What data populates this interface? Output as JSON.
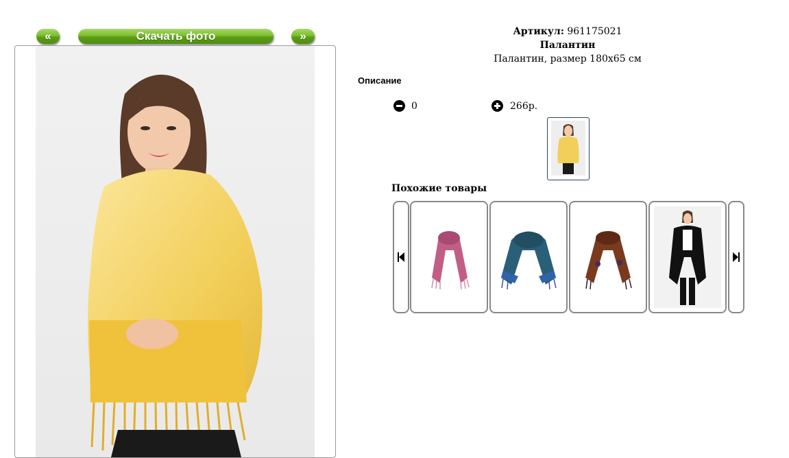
{
  "nav": {
    "prev_label": "«",
    "download_label": "Скачать фото",
    "next_label": "»"
  },
  "product": {
    "article_label": "Артикул:",
    "article_value": "961175021",
    "name": "Палантин",
    "description": "Палантин, размер 180х65 см"
  },
  "description_heading": "Описание",
  "cart": {
    "quantity": "0",
    "price": "266р."
  },
  "similar": {
    "heading": "Похожие товары",
    "items": [
      {
        "kind": "scarf",
        "color": "#c25e86"
      },
      {
        "kind": "scarf",
        "color": "#2a5f78"
      },
      {
        "kind": "scarf",
        "color": "#7a3a1e"
      },
      {
        "kind": "model-black",
        "color": "#111111"
      }
    ]
  },
  "colors": {
    "button_green": "#5c9c18",
    "scarf_main": "#f2cf5a",
    "border_gray": "#888888"
  },
  "icons": {
    "minus": "minus-circle-icon",
    "plus": "plus-circle-icon",
    "carousel_prev": "skip-previous-icon",
    "carousel_next": "skip-next-icon"
  }
}
